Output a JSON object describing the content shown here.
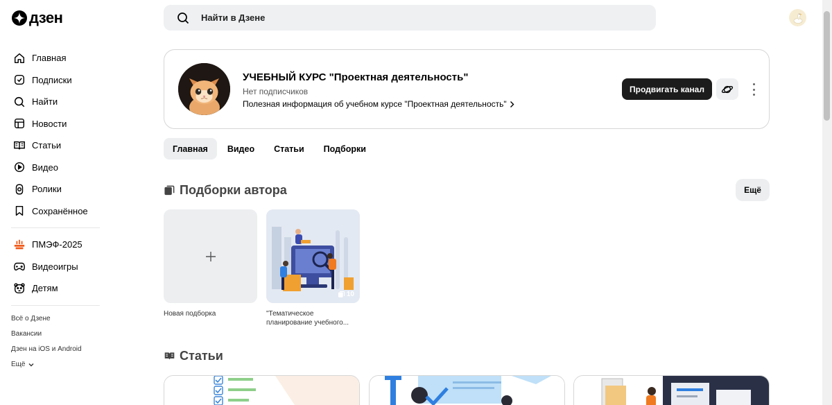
{
  "brand": {
    "logo_text": "дзен"
  },
  "search": {
    "placeholder": "Найти в Дзене"
  },
  "sidebar": {
    "items": [
      {
        "label": "Главная",
        "icon": "home-icon"
      },
      {
        "label": "Подписки",
        "icon": "subscriptions-icon"
      },
      {
        "label": "Найти",
        "icon": "search-icon"
      },
      {
        "label": "Новости",
        "icon": "news-icon"
      },
      {
        "label": "Статьи",
        "icon": "articles-icon"
      },
      {
        "label": "Видео",
        "icon": "video-icon"
      },
      {
        "label": "Ролики",
        "icon": "shorts-icon"
      },
      {
        "label": "Сохранённое",
        "icon": "bookmark-icon"
      }
    ],
    "extra_items": [
      {
        "label": "ПМЭФ-2025",
        "icon": "spief-icon"
      },
      {
        "label": "Видеоигры",
        "icon": "gamepad-icon"
      },
      {
        "label": "Детям",
        "icon": "kids-bear-icon"
      }
    ],
    "footer_links": [
      "Всё о Дзене",
      "Вакансии",
      "Дзен на iOS и Android",
      "Ещё"
    ]
  },
  "channel": {
    "title": "УЧЕБНЫЙ КУРС \"Проектная деятельность\"",
    "subscribers": "Нет подписчиков",
    "description": "Полезная информация об учебном курсе \"Проектная деятельность\"",
    "promote_label": "Продвигать канал"
  },
  "tabs": [
    {
      "label": "Главная",
      "active": true
    },
    {
      "label": "Видео",
      "active": false
    },
    {
      "label": "Статьи",
      "active": false
    },
    {
      "label": "Подборки",
      "active": false
    }
  ],
  "collections_section": {
    "title": "Подборки автора",
    "more_label": "Ещё",
    "items": [
      {
        "caption": "Новая подборка"
      },
      {
        "caption": "\"Тематическое планирование учебного...",
        "count": "10"
      }
    ]
  },
  "articles_section": {
    "title": "Статьи"
  },
  "colors": {
    "accent_dark": "#1c1c1c",
    "chip_bg": "#eceef0",
    "search_bg": "#eef0f2"
  }
}
